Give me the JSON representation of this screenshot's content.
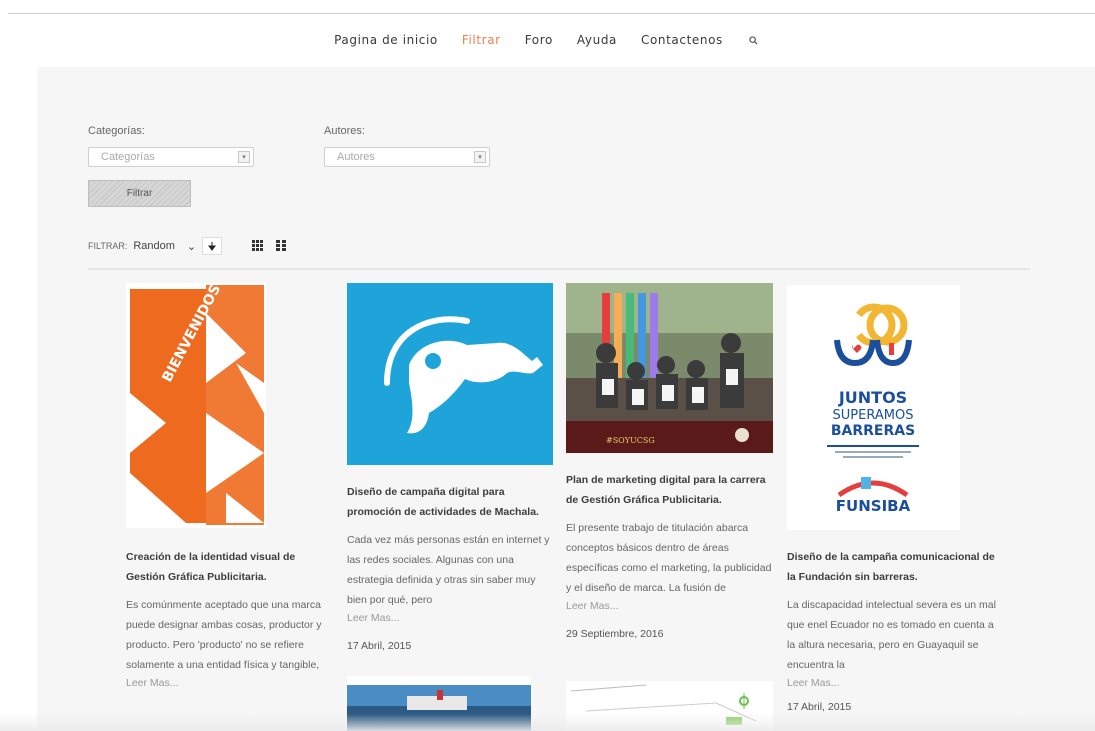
{
  "nav": {
    "items": [
      {
        "label": "Pagina de inicio",
        "active": false
      },
      {
        "label": "Filtrar",
        "active": true
      },
      {
        "label": "Foro",
        "active": false
      },
      {
        "label": "Ayuda",
        "active": false
      },
      {
        "label": "Contactenos",
        "active": false
      }
    ],
    "search_icon": "search-icon",
    "active_color": "#e8834f"
  },
  "filters": {
    "categories_label": "Categorías:",
    "categories_placeholder": "Categorías",
    "authors_label": "Autores:",
    "authors_placeholder": "Autores",
    "submit_label": "Filtrar"
  },
  "sortbar": {
    "label": "FILTRAR:",
    "sort_value": "Random",
    "direction_icon": "arrow-down-icon",
    "view_icons": [
      "grid-icon",
      "list-icon"
    ]
  },
  "cards": [
    {
      "title": "Creación de la identidad visual de Gestión Gráfica Publicitaria.",
      "excerpt": "Es comúnmente aceptado que una marca puede designar ambas cosas, productor y producto. Pero 'producto' no se refiere solamente a una entidad física y tangible,",
      "more": "Leer Mas...",
      "date": "",
      "image_text": "BIENVENIDOS"
    },
    {
      "title": "Diseño de campaña digital para promoción de actividades de Machala.",
      "excerpt": "Cada vez más personas están en internet y las redes sociales. Algunas con una estrategia definida y otras sin saber muy bien por qué, pero",
      "more": "Leer Mas...",
      "date": "17 Abril, 2015"
    },
    {
      "title": "Plan de marketing digital para la carrera de Gestión Gráfica Publicitaria.",
      "excerpt": "El presente trabajo de titulación abarca conceptos básicos dentro de áreas específicas como el marketing, la publicidad y el diseño de marca. La fusión de",
      "more": "Leer Mas...",
      "date": "29 Septiembre, 2016",
      "image_text": "#SOYUCSG"
    },
    {
      "title": "Diseño de la campaña comunicacional de la Fundación sin barreras.",
      "excerpt": "La discapacidad intelectual severa es un mal que enel Ecuador no es tomado en cuenta a la altura necesaria, pero en Guayaquil se encuentra la",
      "more": "Leer Mas...",
      "date": "17 Abril, 2015",
      "image_text": [
        "JUNTOS",
        "SUPERAMOS",
        "BARRERAS"
      ],
      "logo_text": "FUNSIBA"
    }
  ]
}
